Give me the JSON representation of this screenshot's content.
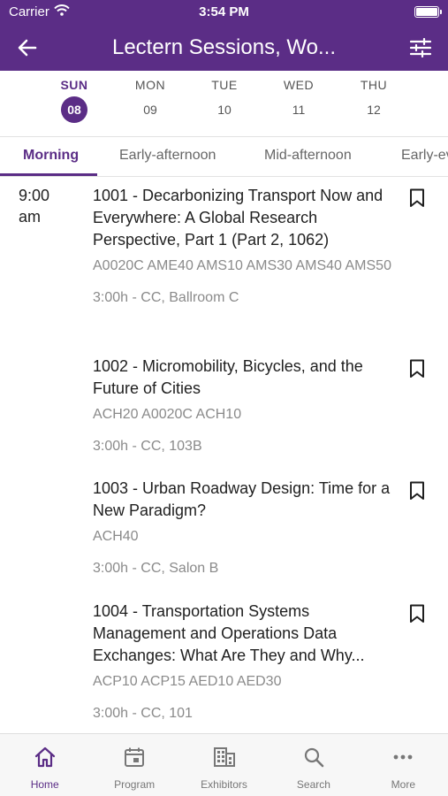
{
  "status": {
    "carrier": "Carrier",
    "time": "3:54 PM",
    "battery_level": 1.0
  },
  "nav": {
    "title": "Lectern Sessions, Wo...",
    "back_icon": "arrow-left-icon",
    "filter_icon": "sliders-icon"
  },
  "dates": [
    {
      "dow": "SUN",
      "num": "08",
      "active": true
    },
    {
      "dow": "MON",
      "num": "09"
    },
    {
      "dow": "TUE",
      "num": "10"
    },
    {
      "dow": "WED",
      "num": "11"
    },
    {
      "dow": "THU",
      "num": "12"
    }
  ],
  "tabs": [
    "Morning",
    "Early-afternoon",
    "Mid-afternoon",
    "Early-ev"
  ],
  "time_slot": {
    "time": "9:00",
    "period": "am"
  },
  "sessions": [
    {
      "title": "1001 - Decarbonizing Transport Now and Everywhere: A Global Research Perspective, Part 1 (Part 2, 1062)",
      "codes": "A0020C AME40 AMS10 AMS30 AMS40 AMS50",
      "location": "3:00h - CC, Ballroom C"
    },
    {
      "title": "1002 - Micromobility, Bicycles, and the Future of Cities",
      "codes": "ACH20 A0020C ACH10",
      "location": "3:00h - CC, 103B"
    },
    {
      "title": "1003 - Urban Roadway Design: Time for a New Paradigm?",
      "codes": "ACH40",
      "location": "3:00h - CC, Salon B"
    },
    {
      "title": "1004 - Transportation Systems Management and Operations Data Exchanges: What Are They and Why...",
      "codes": "ACP10 ACP15 AED10 AED30",
      "location": "3:00h - CC, 101"
    }
  ],
  "bottom_tabs": [
    {
      "label": "Home",
      "icon": "home-icon",
      "active": true
    },
    {
      "label": "Program",
      "icon": "calendar-icon"
    },
    {
      "label": "Exhibitors",
      "icon": "building-icon"
    },
    {
      "label": "Search",
      "icon": "search-icon"
    },
    {
      "label": "More",
      "icon": "more-icon"
    }
  ],
  "colors": {
    "accent": "#5b2d86",
    "text_secondary": "#8a8a8a"
  }
}
